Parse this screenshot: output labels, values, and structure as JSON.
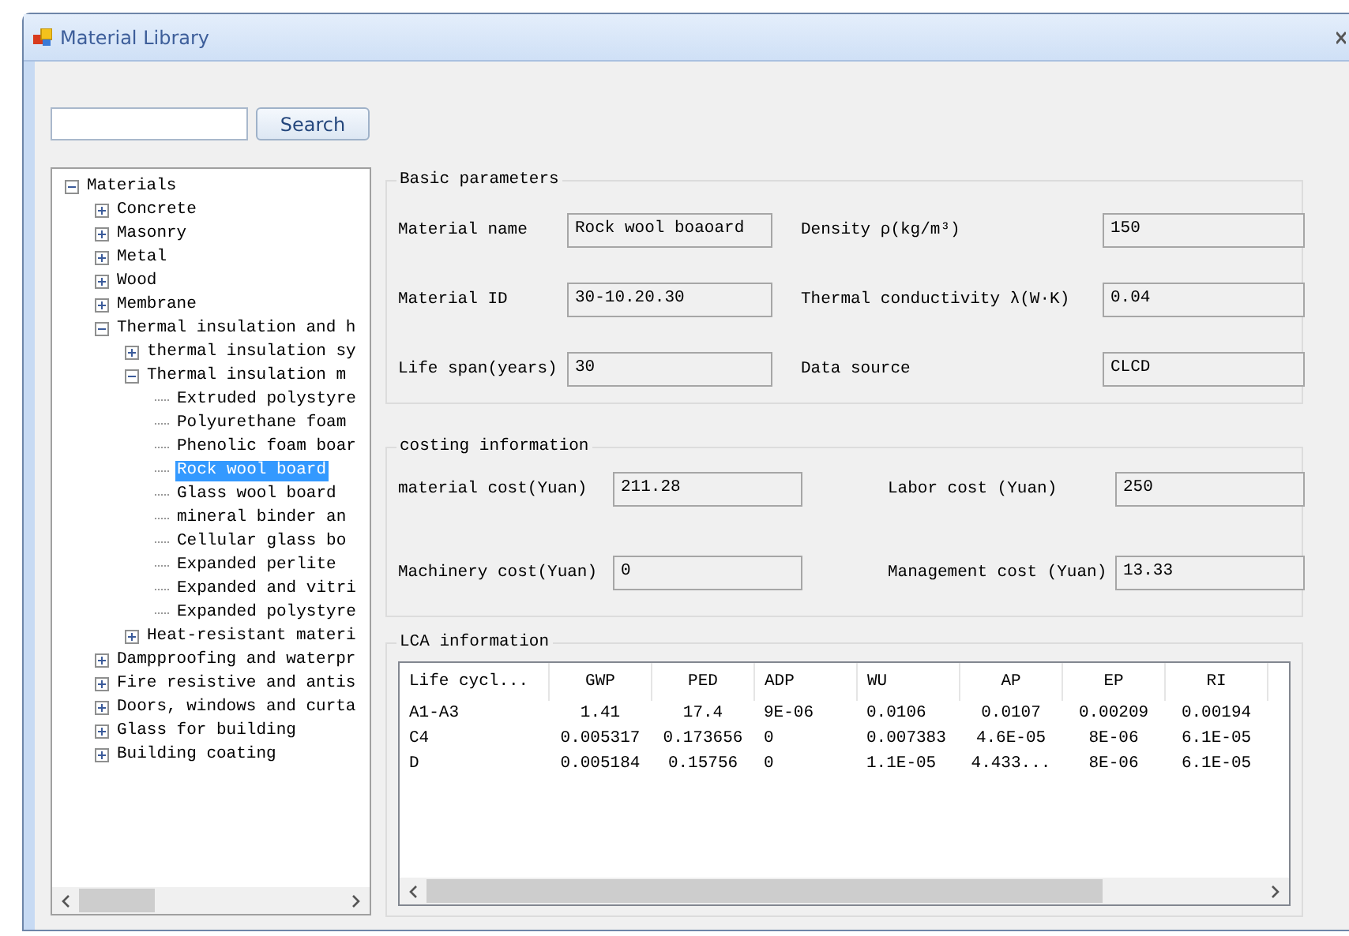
{
  "window": {
    "title": "Material Library"
  },
  "search": {
    "button": "Search"
  },
  "tree": [
    {
      "label": "Materials",
      "expanded": true,
      "selected": false,
      "children": [
        {
          "label": "Concrete",
          "expanded": false,
          "selected": false
        },
        {
          "label": "Masonry",
          "expanded": false,
          "selected": false
        },
        {
          "label": "Metal",
          "expanded": false,
          "selected": false
        },
        {
          "label": "Wood",
          "expanded": false,
          "selected": false
        },
        {
          "label": "Membrane",
          "expanded": false,
          "selected": false
        },
        {
          "label": "Thermal insulation and h",
          "expanded": true,
          "selected": false,
          "children": [
            {
              "label": "thermal insulation sy",
              "expanded": false,
              "selected": false
            },
            {
              "label": "Thermal insulation m",
              "expanded": true,
              "selected": false,
              "children": [
                {
                  "label": "Extruded polystyre",
                  "selected": false
                },
                {
                  "label": "Polyurethane foam",
                  "selected": false
                },
                {
                  "label": "Phenolic foam boar",
                  "selected": false
                },
                {
                  "label": "Rock wool board",
                  "selected": true
                },
                {
                  "label": "Glass wool board",
                  "selected": false
                },
                {
                  "label": "mineral binder an",
                  "selected": false
                },
                {
                  "label": "Cellular glass bo",
                  "selected": false
                },
                {
                  "label": "Expanded perlite",
                  "selected": false
                },
                {
                  "label": "Expanded and vitri",
                  "selected": false
                },
                {
                  "label": "Expanded polystyre",
                  "selected": false
                }
              ]
            },
            {
              "label": "Heat-resistant materi",
              "expanded": false,
              "selected": false
            }
          ]
        },
        {
          "label": "Dampproofing and waterpr",
          "expanded": false,
          "selected": false
        },
        {
          "label": "Fire resistive and antis",
          "expanded": false,
          "selected": false
        },
        {
          "label": "Doors, windows and curta",
          "expanded": false,
          "selected": false
        },
        {
          "label": "Glass for building",
          "expanded": false,
          "selected": false
        },
        {
          "label": "Building coating",
          "expanded": false,
          "selected": false
        }
      ]
    }
  ],
  "basic": {
    "title": "Basic parameters",
    "fields": [
      {
        "label": "Material name",
        "value": "Rock wool boaoard"
      },
      {
        "label": "Density ρ(kg/m³)",
        "value": "150"
      },
      {
        "label": "Material ID",
        "value": "30-10.20.30"
      },
      {
        "label": "Thermal conductivity λ(W·K)",
        "value": "0.04"
      },
      {
        "label": "Life span(years)",
        "value": "30"
      },
      {
        "label": "Data source",
        "value": "CLCD"
      }
    ]
  },
  "costing": {
    "title": "costing information",
    "fields": [
      {
        "label": "material cost(Yuan)",
        "value": "211.28"
      },
      {
        "label": "Labor cost (Yuan)",
        "value": "250"
      },
      {
        "label": "Machinery cost(Yuan)",
        "value": "0"
      },
      {
        "label": "Management cost (Yuan)",
        "value": "13.33"
      }
    ]
  },
  "lca": {
    "title": "LCA information",
    "columns": [
      "Life cycl...",
      "GWP",
      "PED",
      "ADP",
      "WU",
      "AP",
      "EP",
      "RI"
    ],
    "rows": [
      [
        "A1-A3",
        "1.41",
        "17.4",
        "9E-06",
        "0.0106",
        "0.0107",
        "0.00209",
        "0.00194"
      ],
      [
        "C4",
        "0.005317",
        "0.173656",
        "0",
        "0.007383",
        "4.6E-05",
        "8E-06",
        "6.1E-05"
      ],
      [
        "D",
        "0.005184",
        "0.15756",
        "0",
        "1.1E-05",
        "4.433...",
        "8E-06",
        "6.1E-05"
      ]
    ]
  }
}
